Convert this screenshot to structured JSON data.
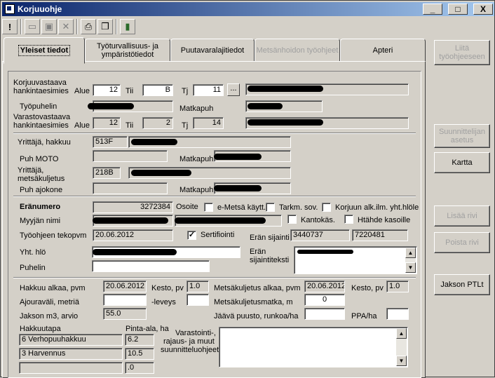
{
  "window": {
    "title": "Korjuuohje",
    "minimize": "_",
    "maximize": "□",
    "close": "X"
  },
  "toolbar": {
    "icons": [
      "exclamation-icon",
      "new-doc-icon",
      "save-icon",
      "delete-icon",
      "print-icon",
      "copy-icon",
      "book-icon"
    ],
    "exclamation": "!"
  },
  "tabs": [
    {
      "label": "Yleiset tiedot"
    },
    {
      "label": "Työturvallisuus- ja ympäristötiedot"
    },
    {
      "label": "Puutavaralajitiedot"
    },
    {
      "label": "Metsänhoidon työohjeet"
    },
    {
      "label": "Apteri"
    }
  ],
  "side": {
    "liita": "Liitä työohjeeseen",
    "suunnittelija": "Suunnittelijan asetus",
    "kartta": "Kartta",
    "lisaa": "Lisää rivi",
    "poista": "Poista rivi",
    "jakson": "Jakson PTLt"
  },
  "korjuu": {
    "label1": "Korjuuvastaava",
    "label2": "hankintaesimies",
    "alue_lbl": "Alue",
    "alue": "12",
    "tii_lbl": "Tii",
    "tii": "B",
    "tj_lbl": "Tj",
    "tj": "11",
    "more": "...",
    "tyopuhelin_lbl": "Työpuhelin",
    "matkapuh_lbl": "Matkapuh"
  },
  "varasto": {
    "label1": "Varastovastaava",
    "label2": "hankintaesimies",
    "alue_lbl": "Alue",
    "alue": "12",
    "tii_lbl": "Tii",
    "tii": "2",
    "tj_lbl": "Tj",
    "tj": "14"
  },
  "yrittaja": {
    "hakkuu_lbl": "Yrittäjä, hakkuu",
    "hakkuu": "513F",
    "puh_moto_lbl": "Puh MOTO",
    "matkapuh_lbl": "Matkapuh",
    "metsa_lbl1": "Yrittäjä,",
    "metsa_lbl2": "metsäkuljetus",
    "metsa": "218B",
    "puh_ajokone_lbl": "Puh ajokone",
    "matkapuh2_lbl": "Matkapuh"
  },
  "era": {
    "eranumero_lbl": "Eränumero",
    "eranumero": "3272384",
    "osoite_lbl": "Osoite",
    "emetsa_lbl": "e-Metsä käytt.",
    "tarkm_lbl": "Tarkm. sov.",
    "korjuun_lbl": "Korjuun alk.ilm. yht.hlöle",
    "myyjan_lbl": "Myyjän nimi",
    "kantokas_lbl": "Kantokäs.",
    "htahde_lbl": "Htähde kasoille",
    "tekopvm_lbl": "Työohjeen tekopvm",
    "tekopvm": "20.06.2012",
    "sertifiointi_lbl": "Sertifiointi",
    "sertifiointi_check": "✓",
    "sijainti_lbl": "Erän sijainti",
    "sijainti1": "3440737",
    "sijainti2": "7220481",
    "yhthlo_lbl": "Yht. hlö",
    "puhelin_lbl": "Puhelin",
    "sijaintiteksti_lbl1": "Erän",
    "sijaintiteksti_lbl2": "sijaintiteksti"
  },
  "hakkuu": {
    "alkaa_lbl": "Hakkuu alkaa, pvm",
    "alkaa": "20.06.2012",
    "kesto_lbl": "Kesto, pv",
    "kesto": "1.0",
    "metsa_alkaa_lbl": "Metsäkuljetus alkaa, pvm",
    "metsa_alkaa": "20.06.2012",
    "metsa_kesto_lbl": "Kesto, pv",
    "metsa_kesto": "1.0",
    "ajoura_lbl": "Ajouraväli, metriä",
    "leveys_lbl": "-leveys",
    "matka_lbl": "Metsäkuljetusmatka, m",
    "matka": "0",
    "jakson_lbl": "Jakson m3, arvio",
    "jakson": "55.0",
    "jaava_lbl": "Jäävä puusto, runkoa/ha",
    "ppa_lbl": "PPA/ha",
    "hakkuutapa_lbl": "Hakkuutapa",
    "pinta_lbl": "Pinta-ala, ha",
    "rows": [
      {
        "tapa": "6  Verhopuuhakkuu",
        "ala": "6.2"
      },
      {
        "tapa": "3  Harvennus",
        "ala": "10.5"
      },
      {
        "tapa": "",
        "ala": ".0"
      }
    ],
    "varastointi_lbl1": "Varastointi-,",
    "varastointi_lbl2": "rajaus- ja muut",
    "varastointi_lbl3": "suunnitteluohjeet"
  }
}
